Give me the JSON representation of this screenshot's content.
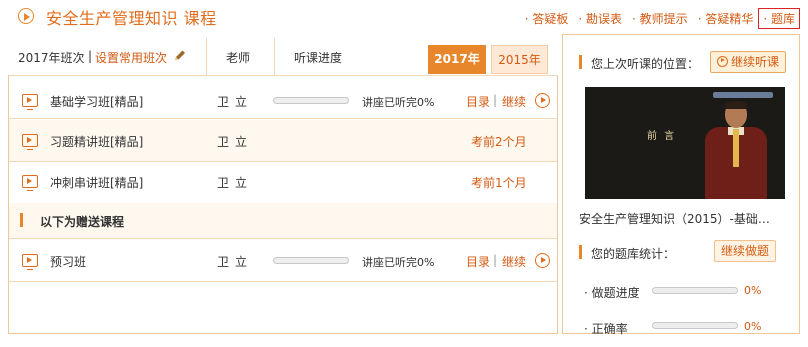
{
  "header": {
    "title": "安全生产管理知识  课程",
    "links": [
      "答疑板",
      "勘误表",
      "教师提示",
      "答疑精华",
      "题库"
    ]
  },
  "table": {
    "year_label": "2017年班次",
    "divider": "|",
    "set_link": "设置常用班次",
    "col_teacher": "老师",
    "col_progress": "听课进度",
    "tabs": [
      "2017年",
      "2015年"
    ],
    "rows": [
      {
        "name": "基础学习班[精品]",
        "teacher": "卫立",
        "progress_text": "讲座已听完0%",
        "progress": 0,
        "link1": "目录",
        "sep": "|",
        "link2": "继续"
      },
      {
        "name": "习题精讲班[精品]",
        "teacher": "卫立",
        "exam": "考前2个月"
      },
      {
        "name": "冲刺串讲班[精品]",
        "teacher": "卫立",
        "exam": "考前1个月"
      }
    ],
    "gift_header": "以下为赠送课程",
    "gift_rows": [
      {
        "name": "预习班",
        "teacher": "卫立",
        "progress_text": "讲座已听完0%",
        "progress": 0,
        "link1": "目录",
        "sep": "|",
        "link2": "继续"
      }
    ]
  },
  "side": {
    "last_pos_label": "您上次听课的位置：",
    "continue_listen": "继续听课",
    "video_caption": "前 言",
    "video_title": "安全生产管理知识（2015）-基础…",
    "bank_label": "您的题库统计：",
    "continue_practice": "继续做题",
    "stats": [
      {
        "label": "做题进度",
        "value": "0%"
      },
      {
        "label": "正确率",
        "value": "0%"
      }
    ]
  },
  "colors": {
    "accent": "#e8862b",
    "link": "#d45a12",
    "border": "#f0c79a"
  }
}
